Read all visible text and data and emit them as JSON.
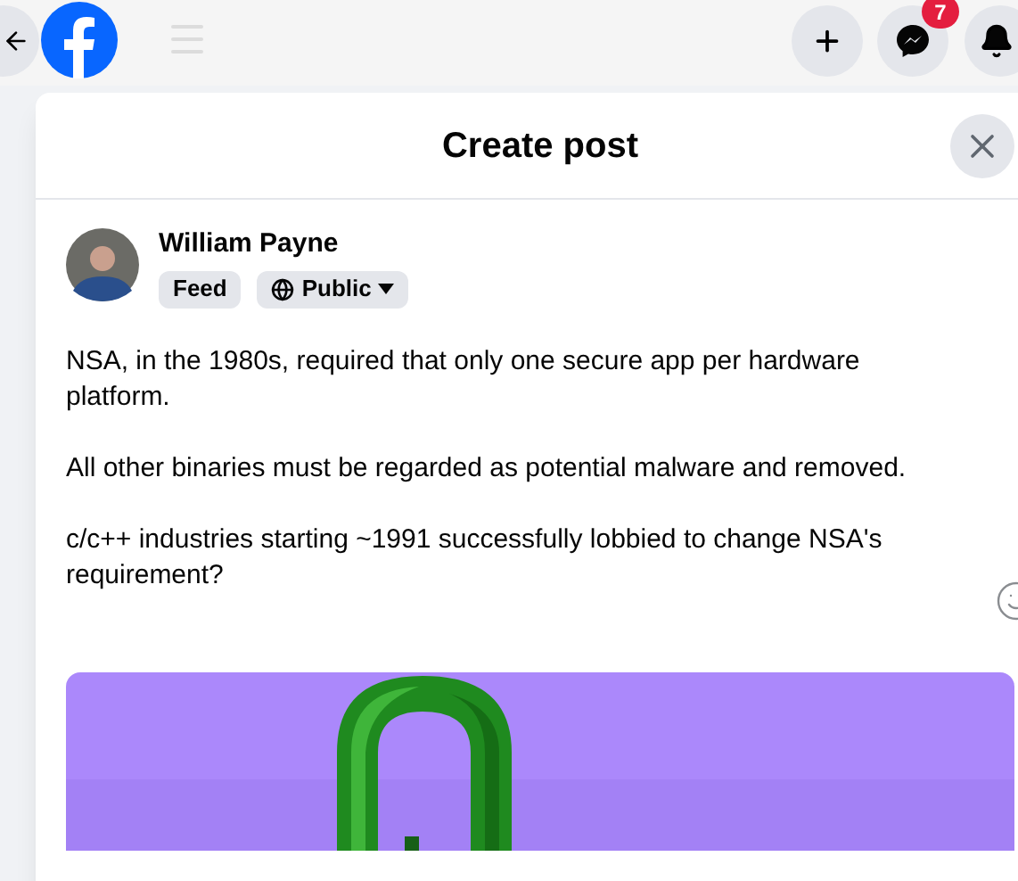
{
  "topbar": {
    "notification_count": "7"
  },
  "dialog": {
    "title": "Create post"
  },
  "author": {
    "name": "William Payne"
  },
  "audience": [
    {
      "label": "Feed",
      "kind": "plain"
    },
    {
      "label": "Public",
      "kind": "dropdown"
    }
  ],
  "post_text": [
    "NSA,  in the 1980s, required that only one secure  app per hardware platform.",
    "All other binaries must be regarded as potential malware and removed.",
    "c/c++ industries starting ~1991 successfully lobbied to change NSA's requirement?"
  ]
}
